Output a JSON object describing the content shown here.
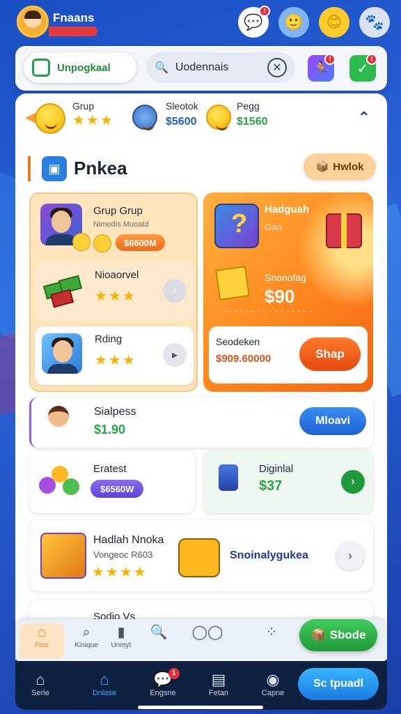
{
  "header": {
    "username": "Fnaans"
  },
  "top_icons": [
    {
      "name": "chat",
      "badge": "!"
    },
    {
      "name": "friend-avatar"
    },
    {
      "name": "smiley"
    },
    {
      "name": "pet"
    }
  ],
  "toolbar": {
    "left_button": "Unpogkaal",
    "search_value": "Uodennais",
    "icon_badges": [
      "!",
      "!"
    ]
  },
  "players": [
    {
      "label": "Grup",
      "value": ""
    },
    {
      "label": "Sleotok",
      "value": "$5600"
    },
    {
      "label": "Pegg",
      "value": "$1560"
    }
  ],
  "section": {
    "title": "Pnkea",
    "button": "Hwlok"
  },
  "left_promo": {
    "row1_name": "Grup Grup",
    "row1_sub": "Nimodis Muoatd",
    "row1_price": "$6600M",
    "item2_name": "Nioaorvel",
    "item3_name": "Rding"
  },
  "right_promo": {
    "title": "Hadguah",
    "subtitle": "Gan",
    "label": "Snonofag",
    "price": "$90",
    "bottom_label": "Seodeken",
    "bottom_price": "$909.60000",
    "buy_button": "Shap"
  },
  "list": {
    "item_a": {
      "name": "Sialpess",
      "price": "$1.90",
      "button": "Mloavi"
    },
    "item_b": {
      "name": "Eratest",
      "pill": "$6560W"
    },
    "item_c": {
      "name": "Diginlal",
      "price": "$37"
    },
    "item_d": {
      "name": "Hadlah Nnoka",
      "sub": "Vongeoc R603",
      "tag": "Snoinalygukea"
    },
    "item_e": {
      "name": "Sodio Vs"
    }
  },
  "tabs2": [
    {
      "label": "Fins",
      "icon": "home-icon"
    },
    {
      "label": "Kinique",
      "icon": "search-icon"
    },
    {
      "label": "Unmyt",
      "icon": "bar-icon"
    },
    {
      "label": "",
      "icon": "search-icon"
    },
    {
      "label": "",
      "icon": "glasses-icon"
    },
    {
      "label": "",
      "icon": "grid-icon"
    }
  ],
  "green_cta": "Sbode",
  "bottom_nav": [
    {
      "label": "Serie",
      "icon": "home-icon"
    },
    {
      "label": "Dnlase",
      "icon": "home-icon"
    },
    {
      "label": "Engsne",
      "icon": "chat-icon",
      "badge": "1"
    },
    {
      "label": "Fetan",
      "icon": "document-icon"
    },
    {
      "label": "Capne",
      "icon": "profile-icon"
    }
  ],
  "blue_cta": "Sc tpuadl"
}
